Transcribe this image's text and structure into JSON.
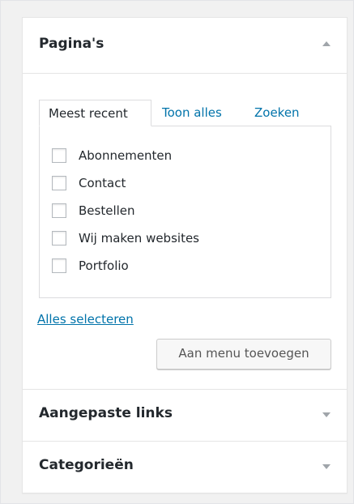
{
  "sections": {
    "pages": {
      "title": "Pagina's",
      "expanded": true
    },
    "custom_links": {
      "title": "Aangepaste links",
      "expanded": false
    },
    "categories": {
      "title": "Categorieën",
      "expanded": false
    }
  },
  "tabs": [
    {
      "label": "Meest recent",
      "active": true
    },
    {
      "label": "Toon alles",
      "active": false
    },
    {
      "label": "Zoeken",
      "active": false
    }
  ],
  "page_items": [
    {
      "label": "Abonnementen",
      "checked": false
    },
    {
      "label": "Contact",
      "checked": false
    },
    {
      "label": "Bestellen",
      "checked": false
    },
    {
      "label": "Wij maken websites",
      "checked": false
    },
    {
      "label": "Portfolio",
      "checked": false
    }
  ],
  "select_all_label": "Alles selecteren",
  "add_to_menu_label": "Aan menu toevoegen",
  "colors": {
    "link": "#0073aa",
    "border": "#e5e5e5",
    "background": "#f1f1f1",
    "arrow": "#a0a5aa"
  },
  "icons": {
    "expanded_arrow": "arrow-up-icon",
    "collapsed_arrow": "arrow-down-icon"
  }
}
